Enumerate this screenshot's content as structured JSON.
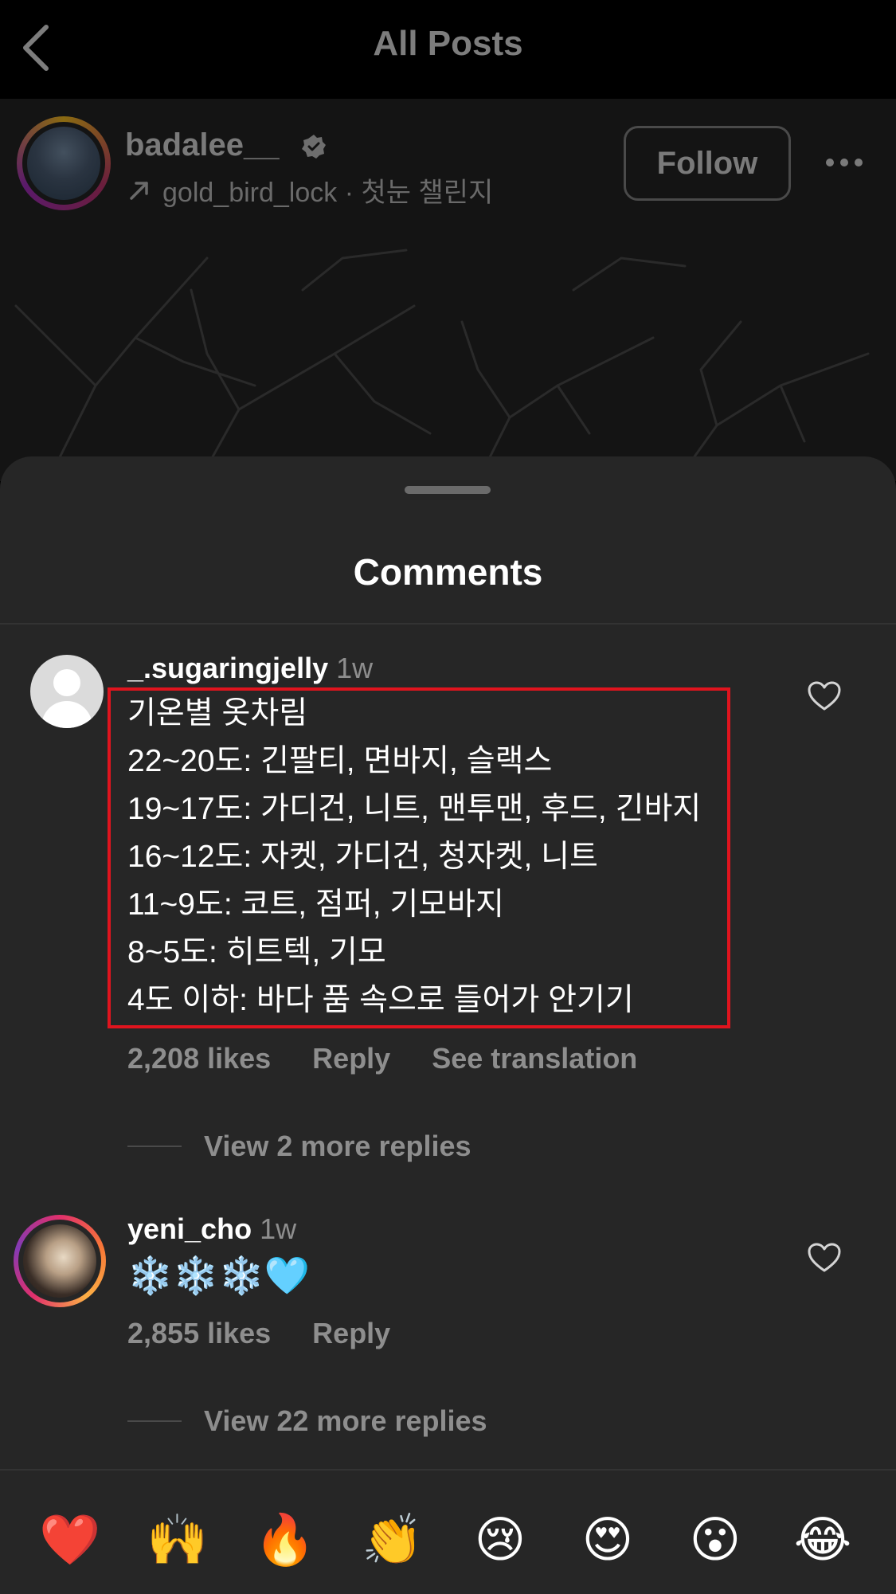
{
  "header": {
    "title": "All Posts"
  },
  "post": {
    "username": "badalee__",
    "subtitle": "gold_bird_lock · 첫눈 챌린지",
    "follow_label": "Follow"
  },
  "comments_sheet": {
    "title": "Comments",
    "comments": [
      {
        "username": "_.sugaringjelly",
        "time": "1w",
        "lines": [
          "기온별 옷차림",
          "22~20도: 긴팔티, 면바지, 슬랙스",
          "19~17도: 가디건, 니트, 맨투맨, 후드, 긴바지",
          "16~12도: 자켓, 가디건, 청자켓, 니트",
          "11~9도: 코트, 점퍼, 기모바지",
          "8~5도: 히트텍, 기모",
          "4도 이하: 바다 품 속으로 들어가 안기기"
        ],
        "likes": "2,208 likes",
        "reply": "Reply",
        "translate": "See translation",
        "view_replies": "View 2 more replies"
      },
      {
        "username": "yeni_cho",
        "time": "1w",
        "text": "❄️❄️❄️🩵",
        "likes": "2,855 likes",
        "reply": "Reply",
        "view_replies": "View 22 more replies"
      }
    ]
  },
  "reactions": [
    "❤️",
    "🙌",
    "🔥",
    "👏",
    "😢",
    "😍",
    "😮",
    "😂"
  ],
  "colors": {
    "highlight": "#e0141e",
    "sheet_bg": "#262626",
    "muted_text": "#8e8e8e"
  }
}
